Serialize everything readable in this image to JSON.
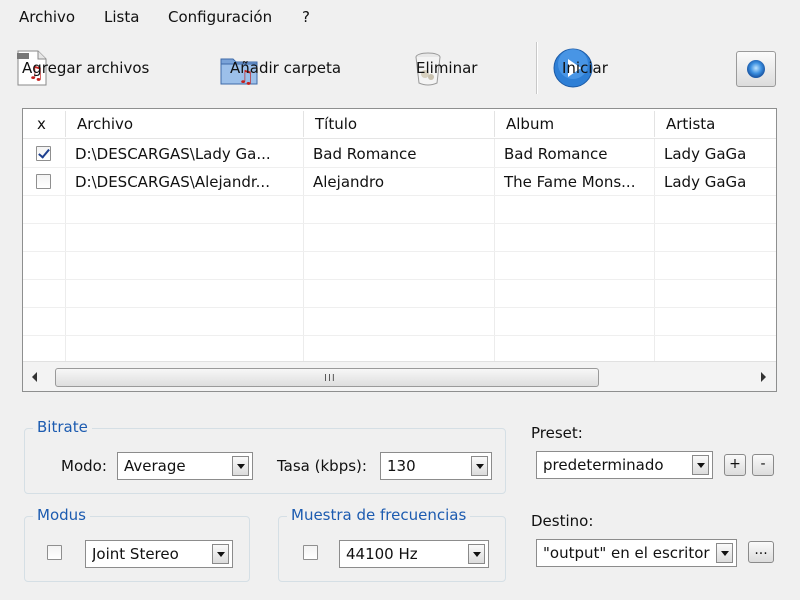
{
  "menu": [
    "Archivo",
    "Lista",
    "Configuración",
    "?"
  ],
  "toolbar": {
    "add_files": "Agregar archivos",
    "add_folder": "Añadir carpeta",
    "delete": "Eliminar",
    "start": "Iniciar"
  },
  "list": {
    "headers": [
      "x",
      "Archivo",
      "Título",
      "Album",
      "Artista"
    ],
    "rows": [
      {
        "checked": true,
        "file": "D:\\DESCARGAS\\Lady Ga...",
        "title": "Bad Romance",
        "album": "Bad Romance",
        "artist": "Lady GaGa"
      },
      {
        "checked": false,
        "file": "D:\\DESCARGAS\\Alejandr...",
        "title": "Alejandro",
        "album": "The Fame Mons...",
        "artist": "Lady GaGa"
      }
    ],
    "scroll_grip": "III"
  },
  "bitrate": {
    "title": "Bitrate",
    "mode_label": "Modo:",
    "mode_value": "Average",
    "rate_label": "Tasa (kbps):",
    "rate_value": "130"
  },
  "preset": {
    "label": "Preset:",
    "value": "predeterminado",
    "add": "+",
    "remove": "-"
  },
  "modus": {
    "title": "Modus",
    "value": "Joint Stereo"
  },
  "frequency": {
    "title": "Muestra de frecuencias",
    "value": "44100 Hz"
  },
  "destination": {
    "label": "Destino:",
    "value": "\"output\" en el escritor",
    "browse": "..."
  },
  "colors": {
    "group_title": "#1c5bb0",
    "start_icon": "#2e7fd6"
  }
}
